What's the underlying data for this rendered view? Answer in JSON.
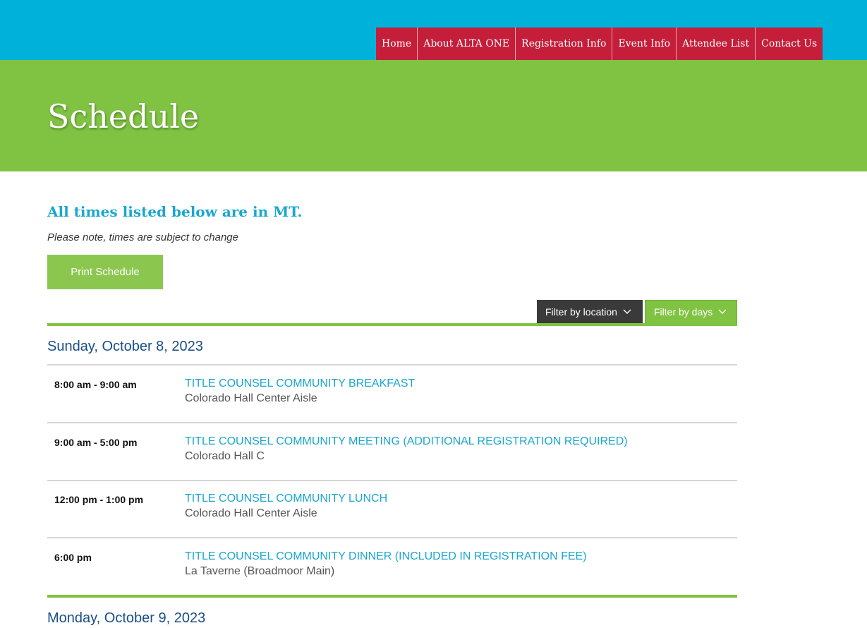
{
  "nav": {
    "items": [
      {
        "label": "Home"
      },
      {
        "label": "About ALTA ONE"
      },
      {
        "label": "Registration Info"
      },
      {
        "label": "Event Info"
      },
      {
        "label": "Attendee List"
      },
      {
        "label": "Contact Us"
      }
    ]
  },
  "colors": {
    "topbar": "#00b2da",
    "nav": "#c41e3a",
    "hero": "#80c342",
    "accent_blue": "#1aa7cf",
    "day_heading": "#1a4e8a"
  },
  "hero": {
    "title": "Schedule"
  },
  "notice": {
    "heading": "All times listed below are in MT.",
    "subtext": "Please note, times are subject to change"
  },
  "print_button": {
    "label": "Print Schedule"
  },
  "filters": {
    "location": {
      "label": "Filter by location",
      "icon": "chevron-down-icon"
    },
    "days": {
      "label": "Filter by days",
      "icon": "chevron-down-icon"
    }
  },
  "days": [
    {
      "date": "Sunday, October 8, 2023",
      "events": [
        {
          "time": "8:00 am - 9:00 am",
          "title": "TITLE COUNSEL COMMUNITY BREAKFAST",
          "location": "Colorado Hall Center Aisle"
        },
        {
          "time": "9:00 am - 5:00 pm",
          "title": "TITLE COUNSEL COMMUNITY MEETING (ADDITIONAL REGISTRATION REQUIRED)",
          "location": "Colorado Hall C"
        },
        {
          "time": "12:00 pm - 1:00 pm",
          "title": "TITLE COUNSEL COMMUNITY LUNCH",
          "location": "Colorado Hall Center Aisle"
        },
        {
          "time": "6:00 pm",
          "title": "TITLE COUNSEL COMMUNITY DINNER (INCLUDED IN REGISTRATION FEE)",
          "location": "La Taverne (Broadmoor Main)"
        }
      ]
    },
    {
      "date": "Monday, October 9, 2023",
      "events": []
    }
  ]
}
